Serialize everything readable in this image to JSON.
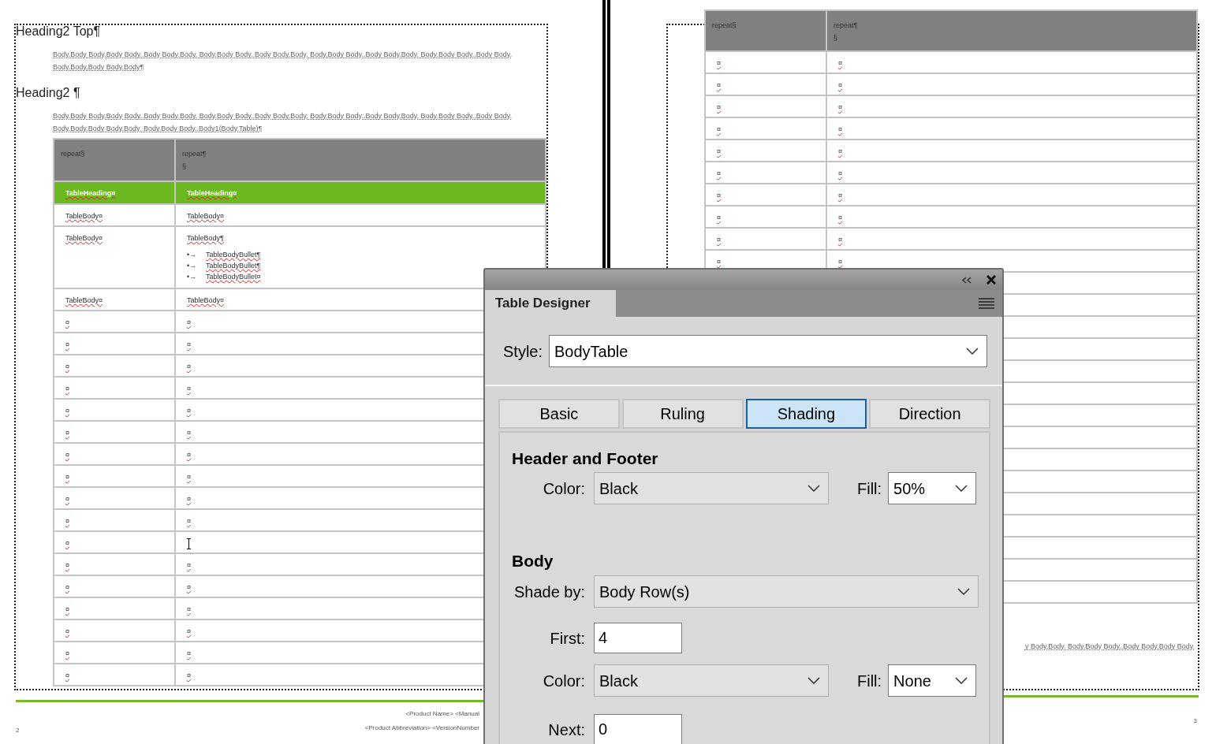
{
  "left_page": {
    "heading_top": "Heading2 Top¶",
    "paragraph_1": "Body.Body Body.Body Body..Body Body.Body. Body.Body Body..Body Body.Body. Body.Body Body..Body Body.Body. Body.Body Body..Body Body. Body.Body.Body Body.Body¶",
    "heading": "Heading2 ¶",
    "paragraph_2": "Body.Body Body.Body Body..Body Body.Body. Body.Body Body..Body Body.Body. Body.Body Body..Body Body.Body. Body.Body Body..Body Body. Body.Body.Body Body.Body. Body.Body Body..Body1(Body.Table)¶",
    "table": {
      "header": [
        {
          "lines": [
            "repeat§"
          ]
        },
        {
          "lines": [
            "repeat¶",
            "§"
          ]
        }
      ],
      "rows": [
        {
          "kind": "heading",
          "cells": [
            {
              "text": "TableHeading¤"
            },
            {
              "text": "TableHeading¤"
            }
          ]
        },
        {
          "kind": "body",
          "cells": [
            {
              "text": "TableBody¤"
            },
            {
              "text": "TableBody¤"
            }
          ]
        },
        {
          "kind": "body",
          "cells": [
            {
              "text": "TableBody¤"
            },
            {
              "text": "TableBody¶",
              "bullets": [
                {
                  "marker": "•→",
                  "text": "TableBodyBullet¶"
                },
                {
                  "marker": "•→",
                  "text": "TableBodyBullet¶"
                },
                {
                  "marker": "•→",
                  "text": "TableBodyBullet¤"
                }
              ]
            }
          ]
        },
        {
          "kind": "body",
          "cells": [
            {
              "text": "TableBody¤"
            },
            {
              "text": "TableBody¤"
            }
          ]
        },
        {
          "kind": "body",
          "cells": [
            {
              "text": "¤"
            },
            {
              "text": "¤"
            }
          ]
        },
        {
          "kind": "body",
          "cells": [
            {
              "text": "¤"
            },
            {
              "text": "¤"
            }
          ]
        },
        {
          "kind": "body",
          "cells": [
            {
              "text": "¤"
            },
            {
              "text": "¤"
            }
          ]
        },
        {
          "kind": "body",
          "cells": [
            {
              "text": "¤"
            },
            {
              "text": "¤"
            }
          ]
        },
        {
          "kind": "body",
          "cells": [
            {
              "text": "¤"
            },
            {
              "text": "¤"
            }
          ]
        },
        {
          "kind": "body",
          "cells": [
            {
              "text": "¤"
            },
            {
              "text": "¤"
            }
          ]
        },
        {
          "kind": "body",
          "cells": [
            {
              "text": "¤"
            },
            {
              "text": "¤"
            }
          ]
        },
        {
          "kind": "body",
          "cells": [
            {
              "text": "¤"
            },
            {
              "text": "¤"
            }
          ]
        },
        {
          "kind": "body",
          "cells": [
            {
              "text": "¤"
            },
            {
              "text": "¤"
            }
          ]
        },
        {
          "kind": "body",
          "cells": [
            {
              "text": "¤"
            },
            {
              "text": "¤"
            }
          ]
        },
        {
          "kind": "body",
          "cells": [
            {
              "text": "¤"
            },
            {
              "cursor": true
            }
          ]
        },
        {
          "kind": "body",
          "cells": [
            {
              "text": "¤"
            },
            {
              "text": "¤"
            }
          ]
        },
        {
          "kind": "body",
          "cells": [
            {
              "text": "¤"
            },
            {
              "text": "¤"
            }
          ]
        },
        {
          "kind": "body",
          "cells": [
            {
              "text": "¤"
            },
            {
              "text": "¤"
            }
          ]
        },
        {
          "kind": "body",
          "cells": [
            {
              "text": "¤"
            },
            {
              "text": "¤"
            }
          ]
        },
        {
          "kind": "body",
          "cells": [
            {
              "text": "¤"
            },
            {
              "text": "¤"
            }
          ]
        },
        {
          "kind": "body",
          "cells": [
            {
              "text": "¤"
            },
            {
              "text": "¤"
            }
          ]
        }
      ]
    },
    "footer": {
      "page_number": "2",
      "line_1": "<Product Name> <Manual",
      "line_2": "<Product Abbreviation> <VersionNumber"
    }
  },
  "right_page": {
    "table": {
      "header": [
        {
          "lines": [
            "repeat§"
          ]
        },
        {
          "lines": [
            "repeat¶",
            "§"
          ]
        }
      ],
      "rows": [
        {
          "kind": "body",
          "cells": [
            {
              "text": "¤"
            },
            {
              "text": "¤"
            }
          ]
        },
        {
          "kind": "body",
          "cells": [
            {
              "text": "¤"
            },
            {
              "text": "¤"
            }
          ]
        },
        {
          "kind": "body",
          "cells": [
            {
              "text": "¤"
            },
            {
              "text": "¤"
            }
          ]
        },
        {
          "kind": "body",
          "cells": [
            {
              "text": "¤"
            },
            {
              "text": "¤"
            }
          ]
        },
        {
          "kind": "body",
          "cells": [
            {
              "text": "¤"
            },
            {
              "text": "¤"
            }
          ]
        },
        {
          "kind": "body",
          "cells": [
            {
              "text": "¤"
            },
            {
              "text": "¤"
            }
          ]
        },
        {
          "kind": "body",
          "cells": [
            {
              "text": "¤"
            },
            {
              "text": "¤"
            }
          ]
        },
        {
          "kind": "body",
          "cells": [
            {
              "text": "¤"
            },
            {
              "text": "¤"
            }
          ]
        },
        {
          "kind": "body",
          "cells": [
            {
              "text": "¤"
            },
            {
              "text": "¤"
            }
          ]
        },
        {
          "kind": "body",
          "cells": [
            {
              "text": "¤"
            },
            {
              "text": "¤"
            }
          ]
        },
        {
          "kind": "body",
          "cells": [
            {},
            {}
          ]
        },
        {
          "kind": "body",
          "cells": [
            {},
            {}
          ]
        },
        {
          "kind": "body",
          "cells": [
            {},
            {}
          ]
        },
        {
          "kind": "body",
          "cells": [
            {},
            {}
          ]
        },
        {
          "kind": "body",
          "cells": [
            {},
            {}
          ]
        },
        {
          "kind": "body",
          "cells": [
            {},
            {}
          ]
        },
        {
          "kind": "body",
          "cells": [
            {},
            {}
          ]
        },
        {
          "kind": "body",
          "cells": [
            {},
            {}
          ]
        },
        {
          "kind": "body",
          "cells": [
            {},
            {}
          ]
        },
        {
          "kind": "body",
          "cells": [
            {},
            {}
          ]
        },
        {
          "kind": "body",
          "cells": [
            {},
            {}
          ]
        },
        {
          "kind": "body",
          "cells": [
            {},
            {}
          ]
        },
        {
          "kind": "body",
          "cells": [
            {},
            {}
          ]
        },
        {
          "kind": "body",
          "cells": [
            {},
            {}
          ]
        },
        {
          "kind": "body",
          "cells": [
            {},
            {}
          ]
        }
      ]
    },
    "paragraph_tail": "y Body.Body. Body.Body Body..Body Body.Body Body.",
    "footer": {
      "page_number": "3"
    }
  },
  "dialog": {
    "panel_tab": "Table Designer",
    "style_label": "Style:",
    "style_value": "BodyTable",
    "tabs": [
      {
        "label": "Basic",
        "selected": false
      },
      {
        "label": "Ruling",
        "selected": false
      },
      {
        "label": "Shading",
        "selected": true
      },
      {
        "label": "Direction",
        "selected": false
      }
    ],
    "header_footer": {
      "title": "Header and Footer",
      "color_label": "Color:",
      "color_value": "Black",
      "fill_label": "Fill:",
      "fill_value": "50%"
    },
    "body": {
      "title": "Body",
      "shade_by_label": "Shade by:",
      "shade_by_value": "Body Row(s)",
      "first_label": "First:",
      "first_value": "4",
      "color_label": "Color:",
      "color_value": "Black",
      "fill_label": "Fill:",
      "fill_value": "None",
      "next_label": "Next:",
      "next_value": "0"
    }
  }
}
